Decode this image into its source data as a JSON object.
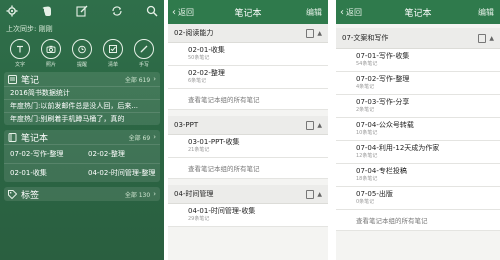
{
  "screen1": {
    "sync_text": "上次同步: 刚刚",
    "top_icons": [
      "gear-icon",
      "evernote-logo-icon",
      "edit-icon",
      "sync-icon",
      "search-icon"
    ],
    "quick_actions": [
      {
        "label": "文字",
        "icon": "text-icon"
      },
      {
        "label": "照片",
        "icon": "camera-icon"
      },
      {
        "label": "提醒",
        "icon": "alarm-icon"
      },
      {
        "label": "清单",
        "icon": "checklist-icon"
      },
      {
        "label": "手写",
        "icon": "handwriting-icon"
      }
    ],
    "notes_section": {
      "title": "笔记",
      "count": "全部 619",
      "items": [
        "2016简书数据统计",
        "年度热门:以前发邮件总是没人回，后来...",
        "年度热门:别刷着手机蹲马桶了，真的"
      ]
    },
    "notebooks_section": {
      "title": "笔记本",
      "count": "全部 69",
      "items": [
        "07-02-写作-整理",
        "02-02-整理",
        "02-01-收集",
        "04-02-时间管理-整理"
      ]
    },
    "tags_section": {
      "title": "标签",
      "count": "全部 130"
    }
  },
  "screen2": {
    "back": "返回",
    "title": "笔记本",
    "edit": "编辑",
    "groups": [
      {
        "header": "02-阅读能力",
        "items": [
          {
            "name": "02-01-收集",
            "count": "50条笔记"
          },
          {
            "name": "02-02-整理",
            "count": "6条笔记"
          }
        ],
        "view_all": "查看笔记本组的所有笔记"
      },
      {
        "header": "03-PPT",
        "items": [
          {
            "name": "03-01-PPT-收集",
            "count": "21条笔记"
          }
        ],
        "view_all": "查看笔记本组的所有笔记"
      },
      {
        "header": "04-时间管理",
        "items": [
          {
            "name": "04-01-时间管理-收集",
            "count": "29条笔记"
          }
        ],
        "view_all": ""
      }
    ]
  },
  "screen3": {
    "back": "返回",
    "title": "笔记本",
    "edit": "编辑",
    "group": {
      "header": "07-文案和写作",
      "items": [
        {
          "name": "07-01-写作-收集",
          "count": "54条笔记"
        },
        {
          "name": "07-02-写作-整理",
          "count": "4条笔记"
        },
        {
          "name": "07-03-写作-分享",
          "count": "2条笔记"
        },
        {
          "name": "07-04-公众号转载",
          "count": "10条笔记"
        },
        {
          "name": "07-04-利用-12天成为作家",
          "count": "12条笔记"
        },
        {
          "name": "07-04-专栏投稿",
          "count": "18条笔记"
        },
        {
          "name": "07-05-出版",
          "count": "0条笔记"
        }
      ],
      "view_all": "查看笔记本组的所有笔记"
    }
  }
}
